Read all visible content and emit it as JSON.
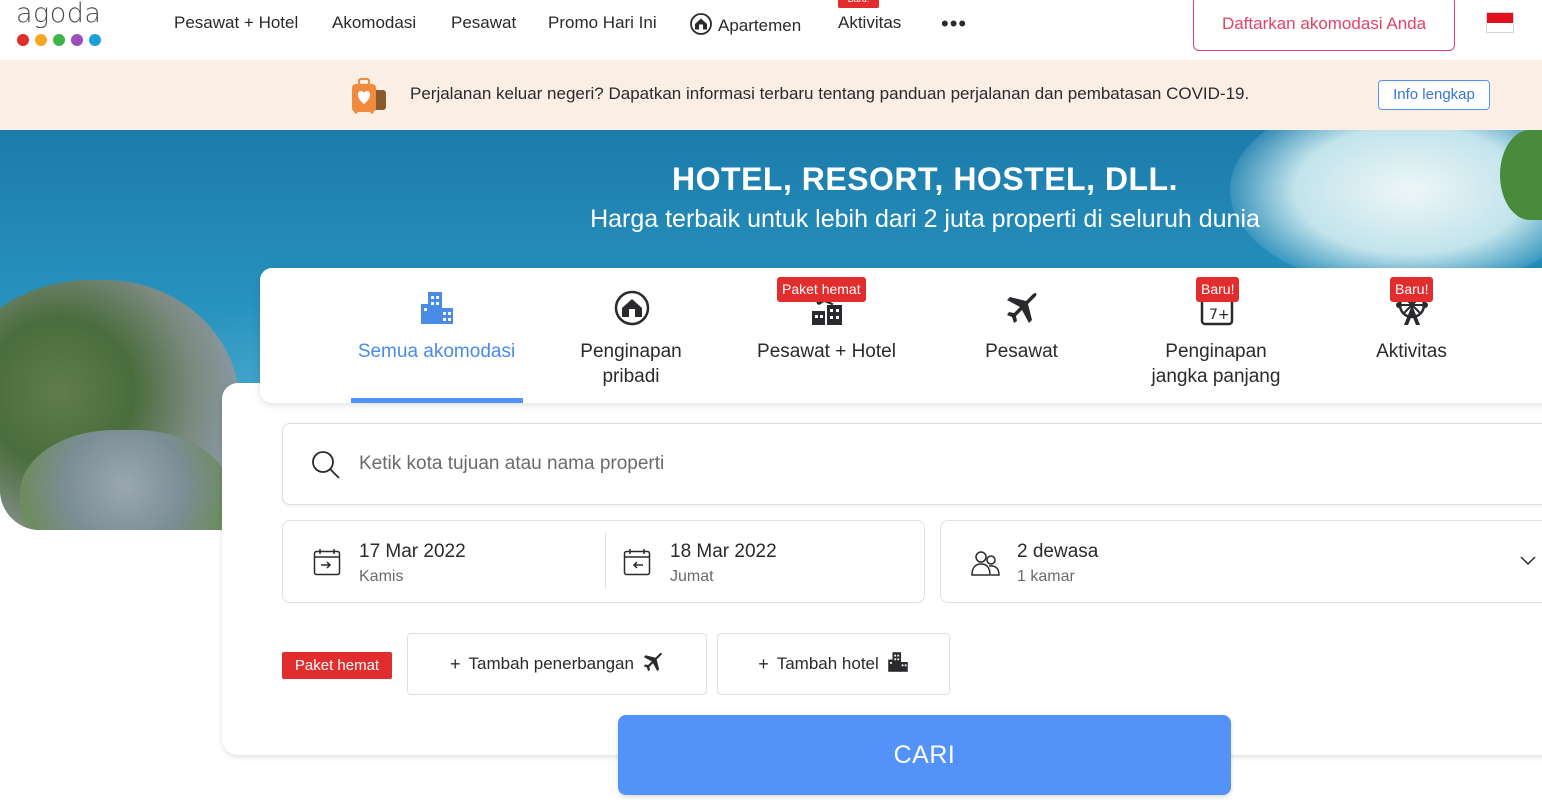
{
  "brand": {
    "logo_text": "agoda",
    "dot_colors": [
      "#e12d2d",
      "#f5a623",
      "#3db54a",
      "#9b4fb8",
      "#1a9fd6"
    ]
  },
  "nav": {
    "items": [
      "Pesawat + Hotel",
      "Akomodasi",
      "Pesawat",
      "Promo Hari Ini",
      "Apartemen",
      "Aktivitas"
    ],
    "new_badge": "Baru!",
    "more": "•••",
    "register": "Daftarkan akomodasi Anda"
  },
  "banner": {
    "text": "Perjalanan keluar negeri? Dapatkan informasi terbaru tentang panduan perjalanan dan pembatasan COVID-19.",
    "button": "Info lengkap"
  },
  "hero": {
    "title": "HOTEL, RESORT, HOSTEL, DLL.",
    "subtitle": "Harga terbaik untuk lebih dari 2 juta properti di seluruh dunia"
  },
  "tabs": [
    {
      "label": "Semua akomodasi",
      "icon": "buildings-icon",
      "badge": ""
    },
    {
      "label": "Penginapan pribadi",
      "icon": "house-icon",
      "badge": ""
    },
    {
      "label": "Pesawat + Hotel",
      "icon": "plane-hotel-icon",
      "badge": "Paket hemat"
    },
    {
      "label": "Pesawat",
      "icon": "plane-icon",
      "badge": ""
    },
    {
      "label": "Penginapan jangka panjang",
      "icon": "calendar-7-icon",
      "badge": "Baru!"
    },
    {
      "label": "Aktivitas",
      "icon": "ferris-wheel-icon",
      "badge": "Baru!"
    }
  ],
  "search": {
    "placeholder": "Ketik kota tujuan atau nama properti"
  },
  "dates": {
    "checkin": {
      "date": "17 Mar 2022",
      "day": "Kamis"
    },
    "checkout": {
      "date": "18 Mar 2022",
      "day": "Jumat"
    }
  },
  "guests": {
    "adults": "2 dewasa",
    "rooms": "1 kamar"
  },
  "package": {
    "badge": "Paket hemat",
    "add_flight": "Tambah penerbangan",
    "add_hotel": "Tambah hotel",
    "plus": "+"
  },
  "submit": "CARI",
  "colors": {
    "accent": "#5392f9",
    "badge_red": "#e12d2d",
    "register_pink": "#e2416b",
    "banner_bg": "#fbeee4"
  }
}
